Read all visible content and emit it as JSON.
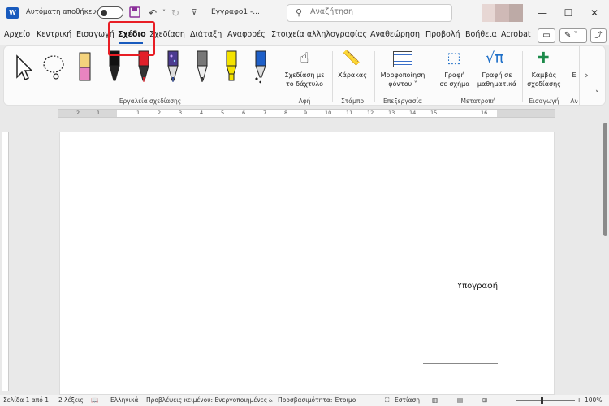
{
  "titlebar": {
    "app_icon_text": "W",
    "autosave_label": "Αυτόματη αποθήκευση",
    "doc_title": "Εγγραφο1  -...",
    "search_placeholder": "Αναζήτηση",
    "icons": [
      "save-icon",
      "undo-icon",
      "redo-icon",
      "customize-icon",
      "search-icon",
      "minimize-icon",
      "maximize-icon",
      "close-icon"
    ]
  },
  "menu": {
    "tabs": [
      "Αρχείο",
      "Κεντρική",
      "Εισαγωγή",
      "Σχέδιο",
      "Σχεδίαση",
      "Διάταξη",
      "Αναφορές",
      "Στοιχεία αλληλογραφίας",
      "Αναθεώρηση",
      "Προβολή",
      "Βοήθεια",
      "Acrobat"
    ],
    "active_tab": "Σχέδιο"
  },
  "ribbon": {
    "groups": {
      "drawing_tools": "Εργαλεία σχεδίασης",
      "touch": "Αφή",
      "stamp": "Στάμπο",
      "edit": "Επεξεργασία",
      "convert": "Μετατροπή",
      "insert": "Εισαγωγή",
      "more": "Αν"
    },
    "buttons": {
      "draw_touch_1": "Σχεδίαση με",
      "draw_touch_2": "το δάχτυλο",
      "ruler": "Χάρακας",
      "format_bg_1": "Μορφοποίηση",
      "format_bg_2": "φόντου ˅",
      "ink_shape_1": "Γραφή",
      "ink_shape_2": "σε σχήμα",
      "ink_math_1": "Γραφή σε",
      "ink_math_2": "μαθηματικά",
      "canvas_1": "Καμβάς",
      "canvas_2": "σχεδίασης",
      "more": "Ε"
    },
    "pen_colors": [
      "#111111",
      "#e0202a",
      "#1e3a8a",
      "#222222",
      "#f4e200",
      "#1e5fc8"
    ]
  },
  "ruler": {
    "numbers": [
      "2",
      "1",
      "1",
      "2",
      "3",
      "4",
      "5",
      "6",
      "7",
      "8",
      "9",
      "10",
      "11",
      "12",
      "13",
      "14",
      "15",
      "16"
    ]
  },
  "document": {
    "signature_label": "Υπογραφή"
  },
  "status": {
    "page": "Σελίδα 1 από 1",
    "words": "2 λέξεις",
    "language": "Ελληνικά",
    "predictions": "Προβλέψεις κειμένου: Ενεργοποιημένες",
    "accessibility": "Προσβασιμότητα: Έτοιμο",
    "focus": "Εστίαση",
    "zoom": "100%"
  }
}
